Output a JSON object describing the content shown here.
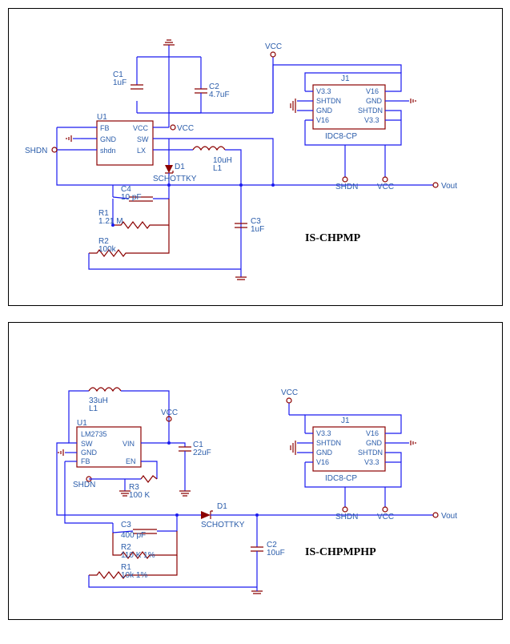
{
  "top": {
    "title": "IS-CHPMP",
    "U1": {
      "ref": "U1",
      "pins": [
        "FB",
        "GND",
        "shdn",
        "VCC",
        "SW",
        "LX"
      ]
    },
    "C1": {
      "ref": "C1",
      "val": "1uF"
    },
    "C2": {
      "ref": "C2",
      "val": "4.7uF"
    },
    "C3": {
      "ref": "C3",
      "val": "1uF"
    },
    "C4": {
      "ref": "C4",
      "val": "10 pF"
    },
    "R1": {
      "ref": "R1",
      "val": "1.21 M"
    },
    "R2": {
      "ref": "R2",
      "val": "100k"
    },
    "L1": {
      "ref": "L1",
      "val": "10uH"
    },
    "D1": {
      "ref": "D1",
      "val": "SCHOTTKY"
    },
    "J1": {
      "ref": "J1",
      "val": "IDC8-CP",
      "pins": [
        "V3.3",
        "V16",
        "SHTDN",
        "GND",
        "GND",
        "SHTDN",
        "V16",
        "V3.3"
      ]
    },
    "nets": {
      "VCC": "VCC",
      "SHDN": "SHDN",
      "Vout": "Vout"
    }
  },
  "bot": {
    "title": "IS-CHPMPHP",
    "U1": {
      "ref": "U1",
      "part": "LM2735",
      "pins": [
        "SW",
        "GND",
        "FB",
        "VIN",
        "EN"
      ]
    },
    "C1": {
      "ref": "C1",
      "val": "22uF"
    },
    "C2": {
      "ref": "C2",
      "val": "10uF"
    },
    "C3": {
      "ref": "C3",
      "val": "400 pF"
    },
    "R1": {
      "ref": "R1",
      "val": "10k 1%"
    },
    "R2": {
      "ref": "R2",
      "val": "110 K 1%"
    },
    "R3": {
      "ref": "R3",
      "val": "100 K"
    },
    "L1": {
      "ref": "L1",
      "val": "33uH"
    },
    "D1": {
      "ref": "D1",
      "val": "SCHOTTKY"
    },
    "J1": {
      "ref": "J1",
      "val": "IDC8-CP",
      "pins": [
        "V3.3",
        "V16",
        "SHTDN",
        "GND",
        "GND",
        "SHTDN",
        "V16",
        "V3.3"
      ]
    },
    "nets": {
      "VCC": "VCC",
      "SHDN": "SHDN",
      "Vout": "Vout"
    }
  }
}
